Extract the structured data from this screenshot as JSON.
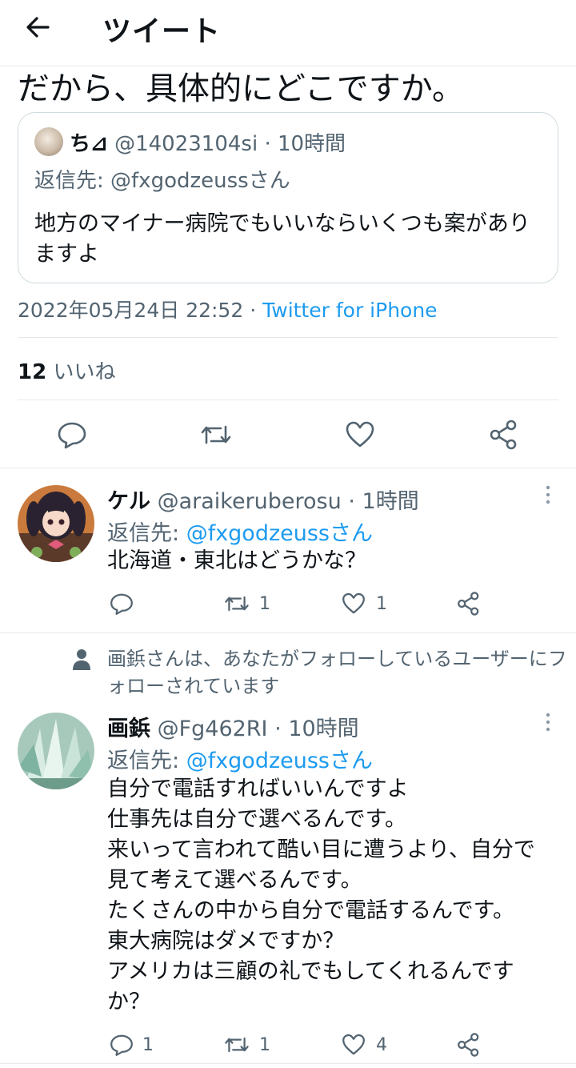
{
  "header": {
    "title": "ツイート"
  },
  "tweet": {
    "text": "だから、具体的にどこですか。",
    "quoted": {
      "name": "ち⊿",
      "handle": "@14023104si",
      "time": "10時間",
      "reply_to": "返信先: @fxgodzeussさん",
      "text": "地方のマイナー病院でもいいならいくつも案がありますよ"
    },
    "timestamp": "2022年05月24日 22:52",
    "source": "Twitter for iPhone",
    "likes_count": "12",
    "likes_label": "いいね"
  },
  "replies": [
    {
      "name": "ケル",
      "handle": "@araikeruberosu",
      "time": "1時間",
      "reply_prefix": "返信先: ",
      "reply_handle": "@fxgodzeussさん",
      "text": "北海道・東北はどうかな？",
      "retweets": "1",
      "likes": "1"
    },
    {
      "social_context": "画鋲さんは、あなたがフォローしているユーザーにフォローされています",
      "name": "画鋲",
      "handle": "@Fg462RI",
      "time": "10時間",
      "reply_prefix": "返信先: ",
      "reply_handle": "@fxgodzeussさん",
      "text": "自分で電話すればいいんですよ\n仕事先は自分で選べるんです。\n来いって言われて酷い目に遭うより、自分で\n見て考えて選べるんです。\nたくさんの中から自分で電話するんです。\n東大病院はダメですか？\nアメリカは三顧の礼でもしてくれるんです\nか？",
      "comments": "1",
      "retweets": "1",
      "likes": "4"
    }
  ],
  "colors": {
    "accent": "#1d9bf0",
    "secondary_text": "#536471",
    "divider": "#e6e9eb"
  },
  "icons": [
    "back-arrow-icon",
    "reply-icon",
    "retweet-icon",
    "like-icon",
    "share-icon",
    "more-icon",
    "person-icon"
  ]
}
